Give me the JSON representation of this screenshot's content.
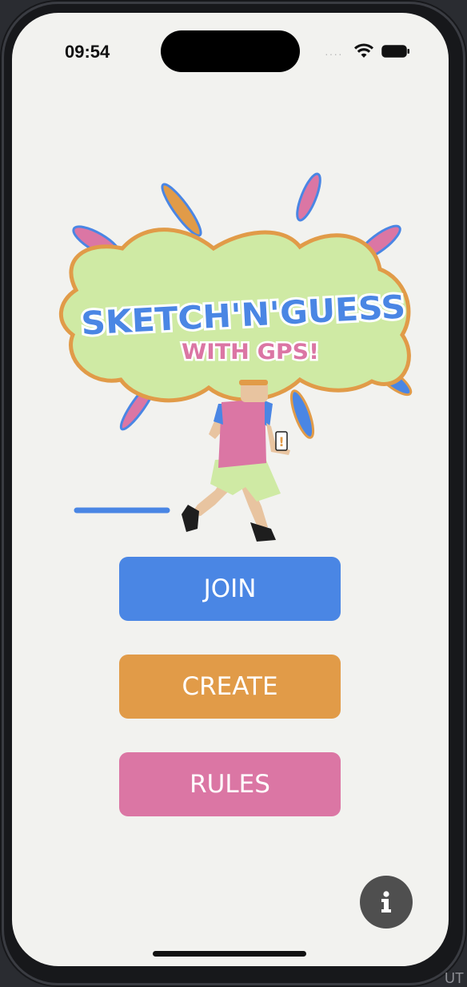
{
  "status_bar": {
    "time": "09:54",
    "signal": "····",
    "wifi_icon": "wifi-icon",
    "battery_icon": "battery-icon"
  },
  "logo": {
    "title": "SKETCH'N'GUESS",
    "subtitle": "WITH GPS!",
    "phone_glyph": "!"
  },
  "buttons": {
    "join_label": "JOIN",
    "create_label": "CREATE",
    "rules_label": "RULES"
  },
  "info_icon": "i",
  "corner_text": "UT",
  "colors": {
    "join": "#4a86e4",
    "create": "#e19b48",
    "rules": "#db76a4",
    "logo_blob": "#cfeaa4",
    "logo_outline": "#e19b48",
    "background": "#f2f2ef"
  }
}
